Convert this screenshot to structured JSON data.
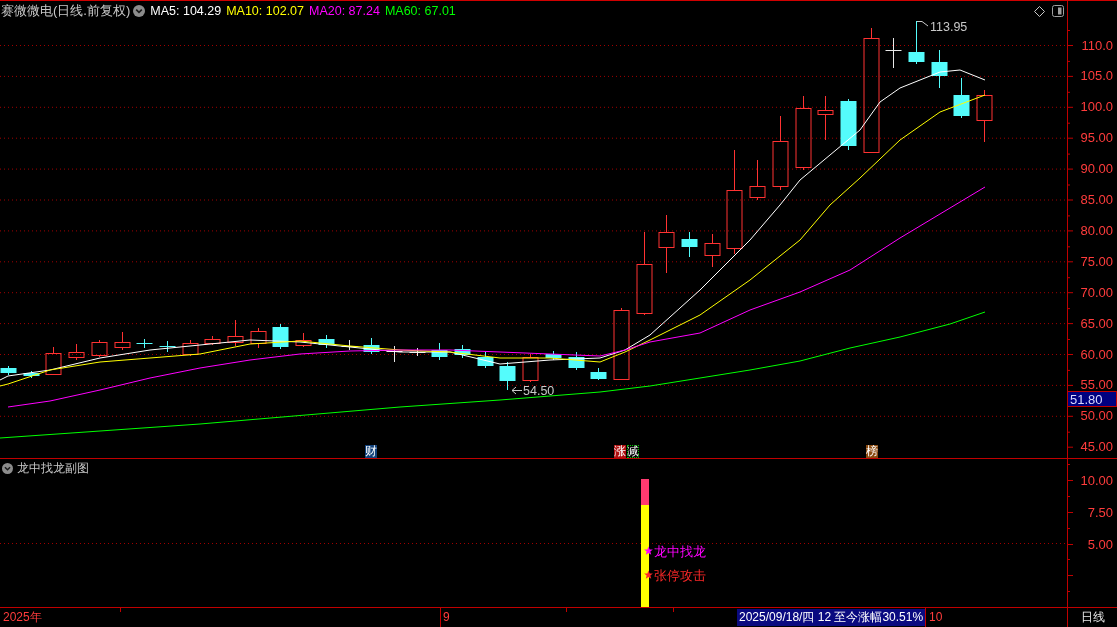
{
  "header": {
    "title": "赛微微电(日线.前复权)",
    "indicators": [
      {
        "label": "MA5: 104.29",
        "color": "#ffffff"
      },
      {
        "label": "MA10: 102.07",
        "color": "#ffff00"
      },
      {
        "label": "MA20: 87.24",
        "color": "#ff00ff"
      },
      {
        "label": "MA60: 67.01",
        "color": "#00ff00"
      }
    ]
  },
  "price_chart": {
    "high_label": "113.95",
    "low_label": "54.50",
    "event_markers": [
      {
        "text": "财",
        "kind": "finance"
      },
      {
        "text": "涨",
        "kind": "limit"
      },
      {
        "text": "减",
        "kind": "reduce"
      },
      {
        "text": "榜",
        "kind": "ranking"
      }
    ]
  },
  "price_axis": {
    "labels": [
      "110.0",
      "105.0",
      "100.0",
      "95.00",
      "90.00",
      "85.00",
      "80.00",
      "75.00",
      "70.00",
      "65.00",
      "60.00",
      "55.00",
      "50.00",
      "45.00"
    ],
    "cursor_price": "51.80"
  },
  "sub_chart": {
    "title": "龙中找龙副图",
    "signals": [
      {
        "label": "龙中找龙",
        "color": "#ff00ff"
      },
      {
        "label": "张停攻击",
        "color": "#ff2828"
      }
    ],
    "axis_labels": [
      "10.00",
      "7.50",
      "5.00"
    ]
  },
  "time_axis": {
    "year": "2025年",
    "months": [
      "9",
      "10"
    ]
  },
  "status_bar": {
    "info": "2025/09/18/四 12 至今涨幅30.51%",
    "period": "日线"
  }
}
